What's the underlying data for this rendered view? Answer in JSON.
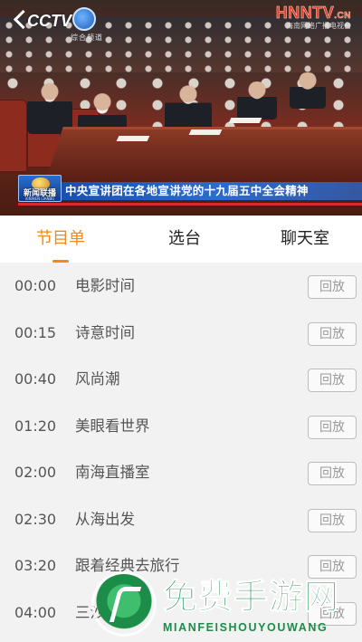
{
  "video": {
    "channel_logo": "CCTV",
    "channel_number": "1",
    "channel_sub": "综合频道",
    "watermark_main": "HNNTV",
    "watermark_domain": ".CN",
    "watermark_sub": "海南网络广播电视台",
    "news_badge_title": "新闻联播",
    "news_badge_sub": "XINWEN LIANBO",
    "headline": "中央宣讲团在各地宣讲党的十九届五中全会精神"
  },
  "tabs": [
    {
      "label": "节目单",
      "active": true
    },
    {
      "label": "选台",
      "active": false
    },
    {
      "label": "聊天室",
      "active": false
    }
  ],
  "programs": [
    {
      "time": "00:00",
      "title": "电影时间",
      "action": "回放"
    },
    {
      "time": "00:15",
      "title": "诗意时间",
      "action": "回放"
    },
    {
      "time": "00:40",
      "title": "风尚潮",
      "action": "回放"
    },
    {
      "time": "01:20",
      "title": "美眼看世界",
      "action": "回放"
    },
    {
      "time": "02:00",
      "title": "南海直播室",
      "action": "回放"
    },
    {
      "time": "02:30",
      "title": "从海出发",
      "action": "回放"
    },
    {
      "time": "03:20",
      "title": "跟着经典去旅行",
      "action": "回放"
    },
    {
      "time": "04:00",
      "title": "三沙时刻",
      "action": "回放"
    }
  ],
  "watermark": {
    "title": "免费手游网",
    "subtitle": "MIANFEISHOUYOUWANG"
  },
  "colors": {
    "accent": "#f08a1c",
    "headline_bg": "#2d6ad0",
    "watermark_green": "#1c8d49"
  }
}
